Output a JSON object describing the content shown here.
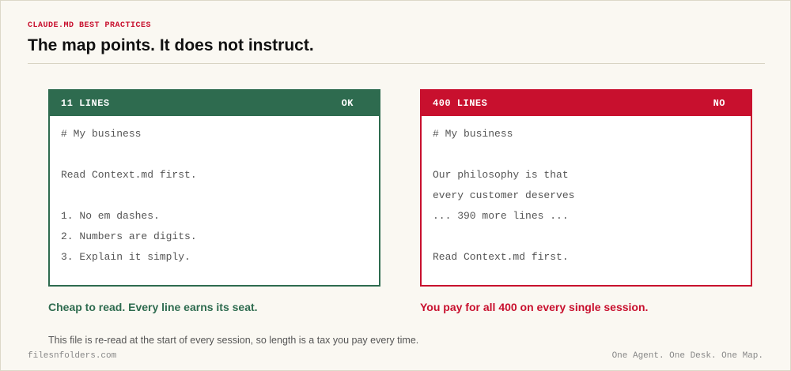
{
  "header": {
    "eyebrow": "CLAUDE.MD BEST PRACTICES",
    "title": "The map points. It does not instruct."
  },
  "good_panel": {
    "label": "11 LINES",
    "verdict": "OK",
    "lines": [
      "# My business",
      "",
      "Read Context.md first.",
      "",
      "1. No em dashes.",
      "2. Numbers are digits.",
      "3. Explain it simply."
    ],
    "caption": "Cheap to read. Every line earns its seat."
  },
  "bad_panel": {
    "label": "400 LINES",
    "verdict": "NO",
    "lines": [
      "# My business",
      "",
      "Our philosophy is that",
      "every customer deserves",
      "... 390 more lines ...",
      "",
      "Read Context.md first."
    ],
    "caption": "You pay for all 400 on every single session."
  },
  "note": "This file is re-read at the start of every session, so length is a tax you pay every time.",
  "footer": {
    "left": "filesnfolders.com",
    "right": "One Agent. One Desk. One Map."
  },
  "colors": {
    "good": "#2e6b4f",
    "bad": "#c8102e",
    "background": "#faf8f2"
  }
}
